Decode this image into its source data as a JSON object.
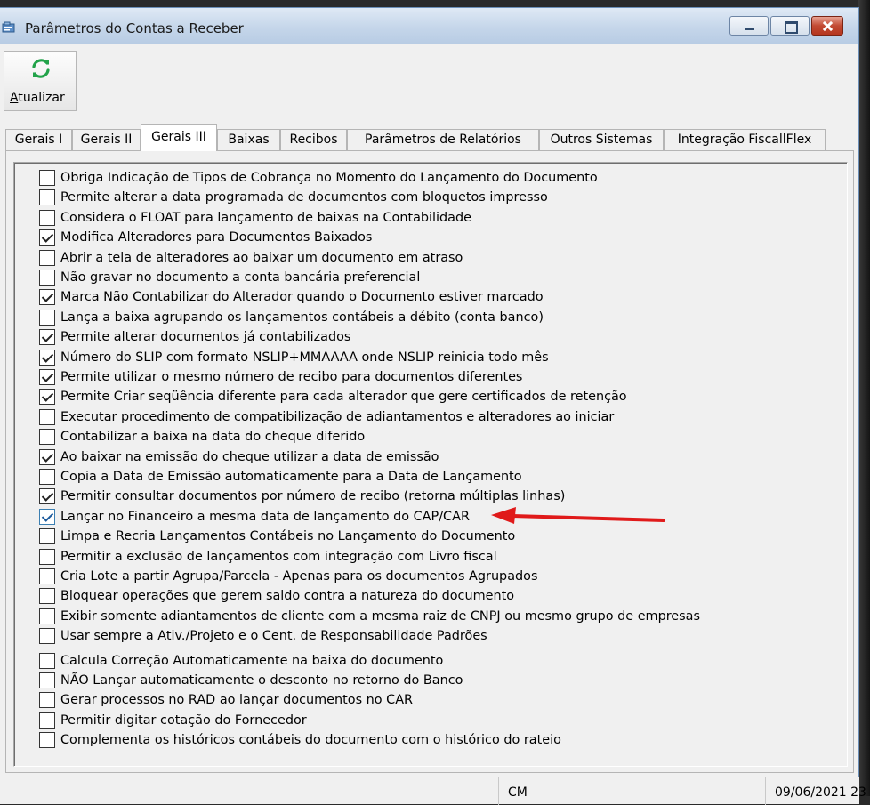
{
  "window": {
    "title": "Parâmetros do Contas a Receber"
  },
  "toolbar": {
    "refresh_label_prefix": "",
    "refresh_label_mnemonic": "A",
    "refresh_label_rest": "tualizar"
  },
  "tabs": [
    {
      "label": "Gerais I",
      "active": false
    },
    {
      "label": "Gerais II",
      "active": false
    },
    {
      "label": "Gerais III",
      "active": true
    },
    {
      "label": "Baixas",
      "active": false
    },
    {
      "label": "Recibos",
      "active": false
    },
    {
      "label": "Parâmetros de Relatórios",
      "active": false
    },
    {
      "label": "Outros Sistemas",
      "active": false
    },
    {
      "label": "Integração FiscallFlex",
      "active": false
    }
  ],
  "options": [
    {
      "label": "Obriga Indicação de Tipos de Cobrança no Momento do Lançamento do Documento",
      "checked": false
    },
    {
      "label": "Permite alterar a data programada de documentos com bloquetos impresso",
      "checked": false
    },
    {
      "label": "Considera o FLOAT para lançamento de baixas na Contabilidade",
      "checked": false
    },
    {
      "label": "Modifica Alteradores para Documentos Baixados",
      "checked": true
    },
    {
      "label": "Abrir a tela de alteradores ao baixar um documento em atraso",
      "checked": false
    },
    {
      "label": "Não gravar no documento a conta bancária preferencial",
      "checked": false
    },
    {
      "label": "Marca Não Contabilizar do Alterador quando o Documento estiver marcado",
      "checked": true
    },
    {
      "label": "Lança a baixa agrupando os lançamentos contábeis a débito (conta banco)",
      "checked": false
    },
    {
      "label": "Permite alterar documentos já contabilizados",
      "checked": true
    },
    {
      "label": "Número do SLIP com formato NSLIP+MMAAAA onde NSLIP reinicia todo mês",
      "checked": true
    },
    {
      "label": "Permite utilizar o mesmo número de recibo para documentos diferentes",
      "checked": true
    },
    {
      "label": "Permite Criar seqüência diferente para cada alterador que gere certificados de retenção",
      "checked": true
    },
    {
      "label": "Executar procedimento de compatibilização de adiantamentos e alteradores ao iniciar",
      "checked": false
    },
    {
      "label": "Contabilizar a baixa na data do cheque diferido",
      "checked": false
    },
    {
      "label": "Ao baixar na emissão do cheque utilizar a data de emissão",
      "checked": true
    },
    {
      "label": "Copia a Data de Emissão automaticamente para a Data de Lançamento",
      "checked": false
    },
    {
      "label": "Permitir consultar documentos por número de recibo (retorna múltiplas linhas)",
      "checked": true
    },
    {
      "label": "Lançar no Financeiro a mesma data de lançamento do CAP/CAR",
      "checked": true,
      "highlighted": true
    },
    {
      "label": "Limpa e Recria Lançamentos Contábeis no Lançamento do Documento",
      "checked": false
    },
    {
      "label": "Permitir a exclusão de lançamentos com integração com Livro fiscal",
      "checked": false
    },
    {
      "label": "Cria Lote a partir Agrupa/Parcela - Apenas para os documentos Agrupados",
      "checked": false
    },
    {
      "label": "Bloquear operações que gerem saldo contra a natureza do documento",
      "checked": false
    },
    {
      "label": "Exibir somente adiantamentos de cliente com a mesma raiz de CNPJ ou mesmo grupo de empresas",
      "checked": false
    },
    {
      "label": "Usar sempre a Ativ./Projeto e o Cent. de Responsabilidade Padrões",
      "checked": false
    },
    {
      "label": "Calcula Correção Automaticamente na baixa do documento",
      "checked": false
    },
    {
      "label": "NÃO Lançar automaticamente o desconto no retorno do Banco",
      "checked": false
    },
    {
      "label": "Gerar processos no RAD ao lançar documentos no CAR",
      "checked": false
    },
    {
      "label": "Permitir digitar cotação do Fornecedor",
      "checked": false
    },
    {
      "label": "Complementa os históricos contábeis do documento com o histórico do rateio",
      "checked": false
    }
  ],
  "annotation": {
    "arrow_color": "#e01a1a"
  },
  "statusbar": {
    "cell1": "CM",
    "cell2": "09/06/2021 23"
  }
}
